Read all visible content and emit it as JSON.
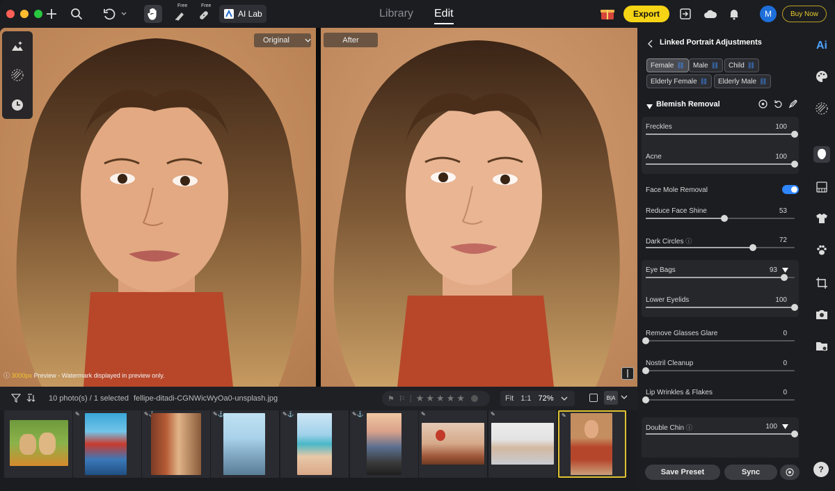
{
  "topbar": {
    "free_label_1": "Free",
    "free_label_2": "Free",
    "ailab_label": "AI Lab",
    "nav_library": "Library",
    "nav_edit": "Edit",
    "export_label": "Export",
    "avatar_initial": "M",
    "buy_now_label": "Buy Now",
    "colors": {
      "export": "#f5d415",
      "avatar": "#1e6fd9"
    }
  },
  "canvas": {
    "original_label": "Original",
    "after_label": "After",
    "preview_res": "3000px",
    "preview_text": " Preview - Watermark displayed in preview only."
  },
  "stripbar": {
    "count_text": "10 photo(s) / 1 selected",
    "filename": "fellipe-ditadi-CGNWicWyOa0-unsplash.jpg",
    "fit_label": "Fit",
    "one_to_one": "1:1",
    "zoom_value": "72%",
    "ba_label": "B|A"
  },
  "thumbnails": [
    {
      "name": "puppies"
    },
    {
      "name": "red-temple"
    },
    {
      "name": "alley"
    },
    {
      "name": "city-tower"
    },
    {
      "name": "beach"
    },
    {
      "name": "sunset-dog"
    },
    {
      "name": "balloons"
    },
    {
      "name": "family"
    },
    {
      "name": "portrait"
    }
  ],
  "panel": {
    "title": "Linked Portrait Adjustments",
    "tags": [
      "Female",
      "Male",
      "Child",
      "Elderly Female",
      "Elderly Male"
    ],
    "section": "Blemish Removal",
    "freckles": {
      "label": "Freckles",
      "value": "100",
      "pct": 1.0
    },
    "acne": {
      "label": "Acne",
      "value": "100",
      "pct": 1.0
    },
    "mole": {
      "label": "Face Mole Removal",
      "enabled": true
    },
    "shine": {
      "label": "Reduce Face Shine",
      "value": "53",
      "pct": 0.53
    },
    "dark_circles": {
      "label": "Dark Circles",
      "value": "72",
      "pct": 0.72
    },
    "eye_bags": {
      "label": "Eye Bags",
      "value": "93",
      "pct": 0.93
    },
    "lower_eyelids": {
      "label": "Lower Eyelids",
      "value": "100",
      "pct": 1.0
    },
    "glasses_glare": {
      "label": "Remove Glasses Glare",
      "value": "0",
      "pct": 0.0
    },
    "nostril": {
      "label": "Nostril Cleanup",
      "value": "0",
      "pct": 0.0
    },
    "lip_wrinkles": {
      "label": "Lip Wrinkles & Flakes",
      "value": "0",
      "pct": 0.0
    },
    "double_chin": {
      "label": "Double Chin",
      "value": "100",
      "pct": 1.0
    },
    "save_preset": "Save Preset",
    "sync": "Sync"
  },
  "sidebar": {
    "ai_label": "Ai",
    "help_label": "?"
  }
}
